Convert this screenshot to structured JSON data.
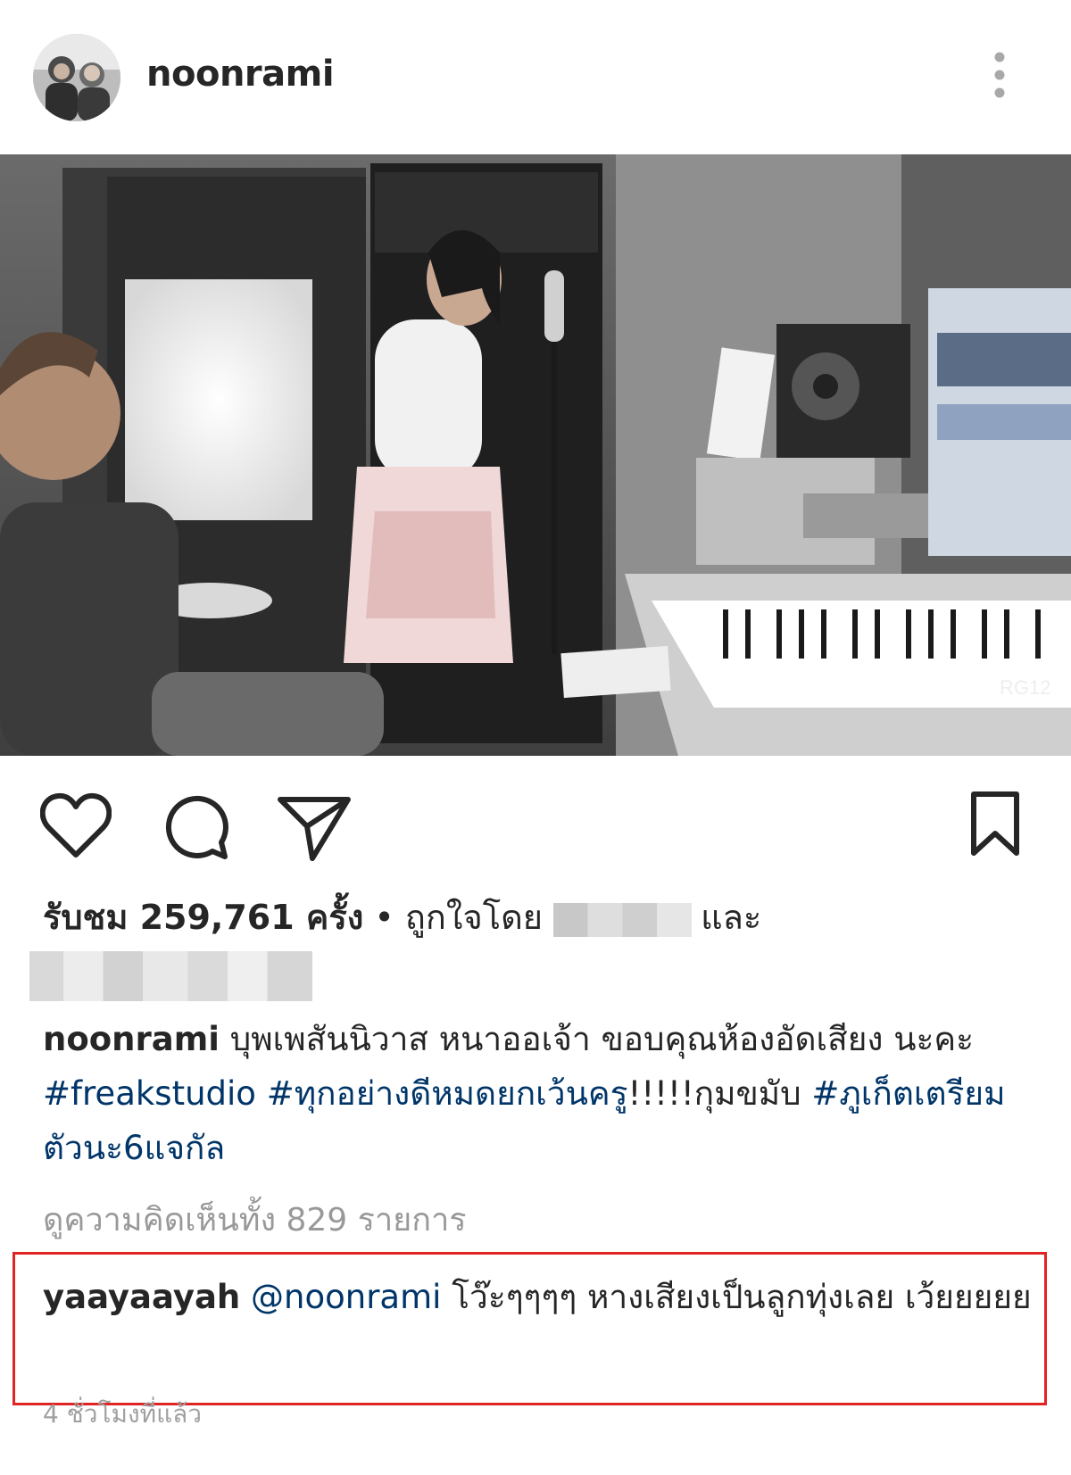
{
  "post": {
    "username": "noonrami",
    "avatar_icon": "profile-photo",
    "more_icon": "vertical-dots-icon"
  },
  "photo": {
    "watermark": "RG12"
  },
  "actions": {
    "like_icon": "heart-outline-icon",
    "comment_icon": "speech-bubble-icon",
    "share_icon": "paper-plane-icon",
    "save_icon": "bookmark-outline-icon"
  },
  "stats": {
    "views_prefix": "รับชม 259,761 ครั้ง",
    "liked_by": " • ถูกใจโดย ",
    "and": "และ"
  },
  "caption": {
    "username": "noonrami",
    "text_1": " บุพเพสันนิวาส หนาออเจ้า ขอบคุณห้องอัดเสียง นะคะ ",
    "tag_1": "#freakstudio",
    "space": " ",
    "tag_2": "#ทุกอย่างดีหมดยกเว้นครู",
    "text_2": "!!!!!กุมขมับ ",
    "tag_3": "#ภูเก็ตเตรียมตัวนะ6แจกัล"
  },
  "view_all_comments": "ดูความคิดเห็นทั้ง 829 รายการ",
  "comment": {
    "username": "yaayaayah",
    "mention": "@noonrami",
    "text": " โว๊ะๆๆๆๆ หางเสียงเป็นลูกทุ่งเลย เว้ยยยยย"
  },
  "timestamp": "4 ชั่วโมงที่แล้ว",
  "colors": {
    "text": "#262626",
    "link": "#003569",
    "muted": "#999999",
    "highlight_border": "#e02424"
  }
}
